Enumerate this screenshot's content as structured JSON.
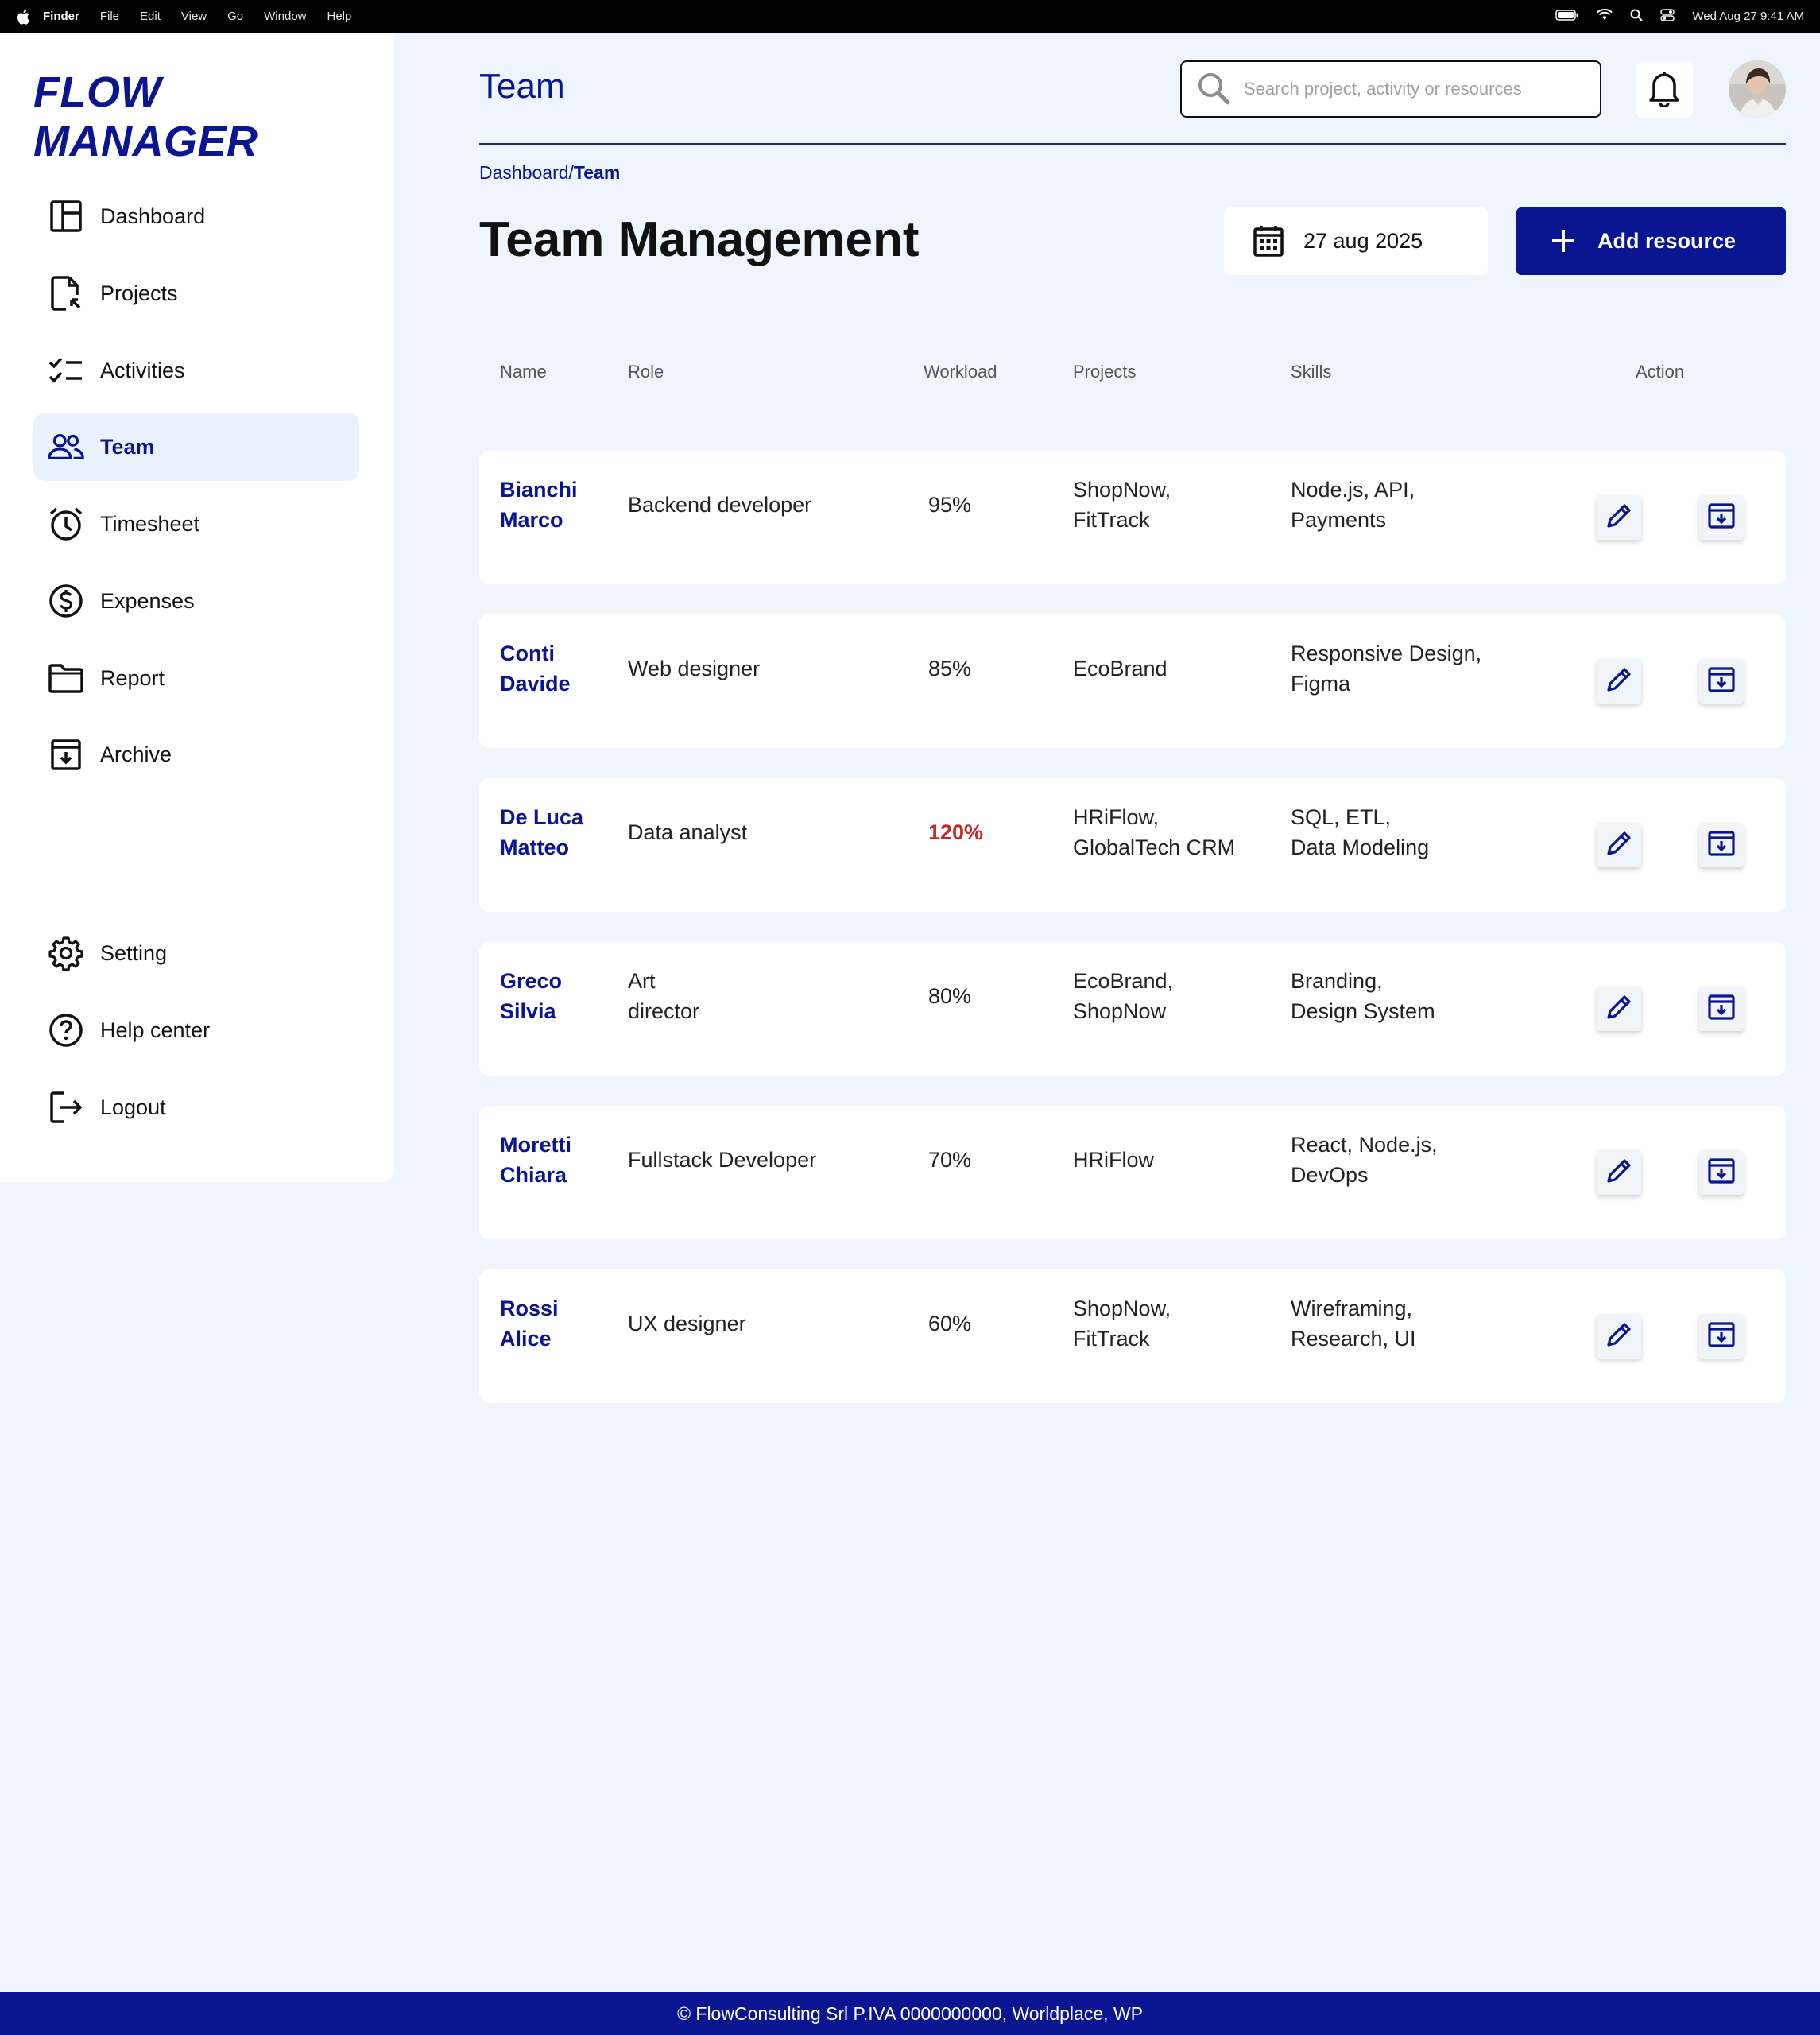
{
  "menubar": {
    "app": "Finder",
    "items": [
      "File",
      "Edit",
      "View",
      "Go",
      "Window",
      "Help"
    ],
    "clock": "Wed Aug 27  9:41 AM"
  },
  "sidebar": {
    "brand": "FLOW MANAGER",
    "items": [
      {
        "label": "Dashboard",
        "icon": "dashboard-icon"
      },
      {
        "label": "Projects",
        "icon": "projects-icon"
      },
      {
        "label": "Activities",
        "icon": "activities-icon"
      },
      {
        "label": "Team",
        "icon": "team-icon",
        "active": true
      },
      {
        "label": "Timesheet",
        "icon": "timesheet-icon"
      },
      {
        "label": "Expenses",
        "icon": "expenses-icon"
      },
      {
        "label": "Report",
        "icon": "report-icon"
      },
      {
        "label": "Archive",
        "icon": "archive-icon"
      }
    ],
    "bottom_items": [
      {
        "label": "Setting",
        "icon": "gear-icon"
      },
      {
        "label": "Help center",
        "icon": "help-icon"
      },
      {
        "label": "Logout",
        "icon": "logout-icon"
      }
    ]
  },
  "header": {
    "title": "Team",
    "search_placeholder": "Search project, activity or resources"
  },
  "breadcrumb": {
    "parent": "Dashboard",
    "separator": "/",
    "current": "Team"
  },
  "main": {
    "title": "Team Management",
    "date": "27 aug 2025",
    "add_label": "Add resource"
  },
  "table": {
    "headers": {
      "name": "Name",
      "role": "Role",
      "workload": "Workload",
      "projects": "Projects",
      "skills": "Skills",
      "action": "Action"
    },
    "rows": [
      {
        "name1": "Bianchi",
        "name2": "Marco",
        "role1": "Backend developer",
        "role2": "",
        "workload": "95%",
        "over": false,
        "proj1": "ShopNow,",
        "proj2": "FitTrack",
        "skill1": "Node.js, API,",
        "skill2": "Payments"
      },
      {
        "name1": "Conti",
        "name2": "Davide",
        "role1": "Web designer",
        "role2": "",
        "workload": "85%",
        "over": false,
        "proj1": "EcoBrand",
        "proj2": "",
        "skill1": "Responsive Design,",
        "skill2": "Figma"
      },
      {
        "name1": "De Luca",
        "name2": "Matteo",
        "role1": "Data analyst",
        "role2": "",
        "workload": "120%",
        "over": true,
        "proj1": "HRiFlow,",
        "proj2": "GlobalTech CRM",
        "skill1": "SQL, ETL,",
        "skill2": "Data Modeling"
      },
      {
        "name1": "Greco",
        "name2": "Silvia",
        "role1": "Art",
        "role2": "director",
        "workload": "80%",
        "over": false,
        "proj1": "EcoBrand,",
        "proj2": "ShopNow",
        "skill1": "Branding,",
        "skill2": "Design System"
      },
      {
        "name1": "Moretti",
        "name2": "Chiara",
        "role1": "Fullstack Developer",
        "role2": "",
        "workload": "70%",
        "over": false,
        "proj1": "HRiFlow",
        "proj2": "",
        "skill1": "React, Node.js,",
        "skill2": "DevOps"
      },
      {
        "name1": "Rossi",
        "name2": "Alice",
        "role1": "UX designer",
        "role2": "",
        "workload": "60%",
        "over": false,
        "proj1": "ShopNow,",
        "proj2": "FitTrack",
        "skill1": "Wireframing,",
        "skill2": "Research, UI"
      }
    ]
  },
  "footer": {
    "text": "© FlowConsulting Srl P.IVA 0000000000, Worldplace, WP"
  },
  "colors": {
    "accent": "#0a1591",
    "background": "#eef5fd",
    "overload": "#c62828"
  }
}
